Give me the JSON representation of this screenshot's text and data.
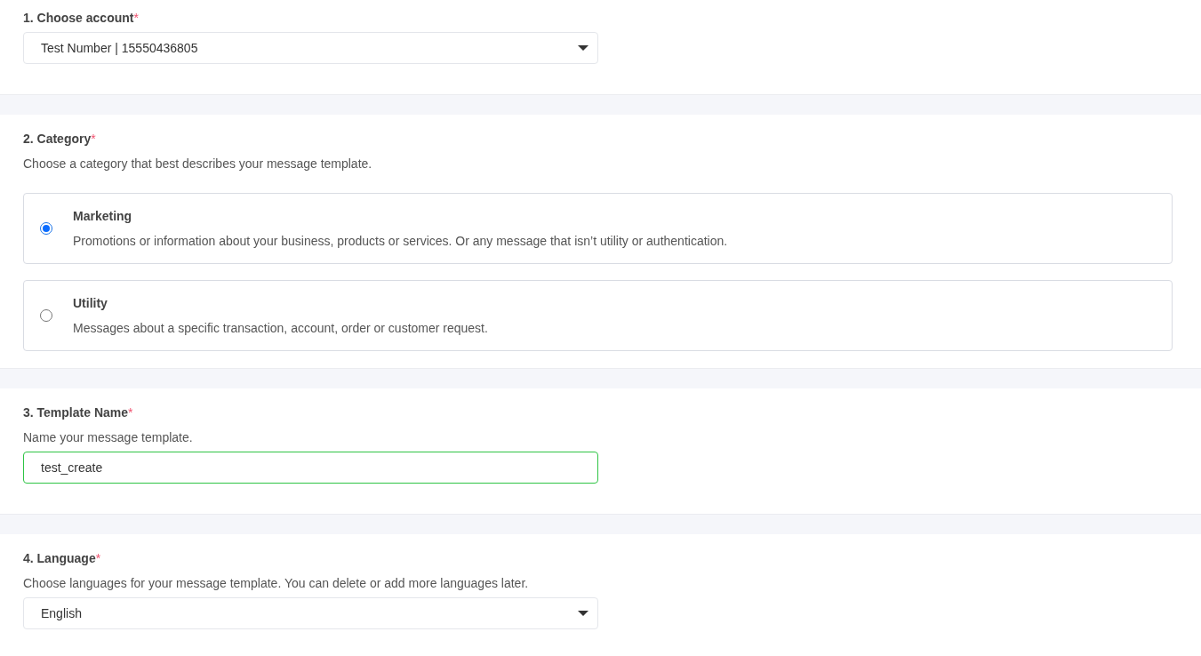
{
  "sections": [
    {
      "title": "1. Choose account",
      "required_mark": "*",
      "dropdown": {
        "value": "Test Number | 15550436805"
      }
    },
    {
      "title": "2. Category",
      "required_mark": "*",
      "description": "Choose a category that best describes your message template.",
      "options": [
        {
          "label": "Marketing",
          "description": "Promotions or information about your business, products or services. Or any message that isn’t utility or authentication.",
          "selected": true
        },
        {
          "label": "Utility",
          "description": "Messages about a specific transaction, account, order or customer request.",
          "selected": false
        }
      ]
    },
    {
      "title": "3. Template Name",
      "required_mark": "*",
      "description": "Name your message template.",
      "input": {
        "value": "test_create",
        "valid": true
      }
    },
    {
      "title": "4. Language",
      "required_mark": "*",
      "description": "Choose languages for your message template. You can delete or add more languages later.",
      "dropdown": {
        "value": "English"
      }
    }
  ]
}
